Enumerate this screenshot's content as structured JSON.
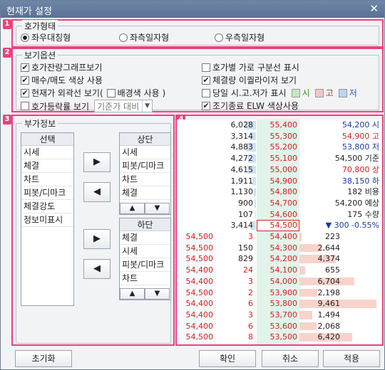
{
  "window": {
    "title": "현재가 설정"
  },
  "markers": [
    "1",
    "2",
    "3",
    "4"
  ],
  "hoga_type": {
    "title": "호가형태",
    "options": [
      {
        "label": "좌우대칭형",
        "selected": true
      },
      {
        "label": "좌측일자형",
        "selected": false
      },
      {
        "label": "우측일자형",
        "selected": false
      }
    ]
  },
  "view_options": {
    "title": "보기옵션",
    "left": [
      {
        "label": "호가잔량그래프보기",
        "checked": true
      },
      {
        "label": "매수/매도 색상 사용",
        "checked": true
      },
      {
        "label": "현재가 외곽선 보기(",
        "checked": true,
        "sub_label": "배경색 사용 )",
        "sub_checked": false
      },
      {
        "label": "호가등락률 보기",
        "checked": false,
        "combo": "기준가 대비"
      }
    ],
    "right": [
      {
        "label": "호가별 가로 구분선 표시",
        "checked": false
      },
      {
        "label": "체결량 이퀄라이저 보기",
        "checked": true
      },
      {
        "label": "당일 시.고.저가 표시",
        "checked": false,
        "colors": [
          {
            "label": "시",
            "color": "#c7e6bf"
          },
          {
            "label": "고",
            "color": "#f3c6c6"
          },
          {
            "label": "저",
            "color": "#bcd3f1"
          }
        ]
      },
      {
        "label": "조기종료 ELW 색상사용",
        "checked": true
      }
    ]
  },
  "extra_info": {
    "title": "부가정보",
    "select_header": "선택",
    "select_items": [
      "시세",
      "체결",
      "차트",
      "피봇/디마크",
      "체결강도",
      "정보미표시"
    ],
    "top_header": "상단",
    "top_items": [
      "시세",
      "피봇/디마크",
      "차트",
      "체결"
    ],
    "bottom_header": "하단",
    "bottom_items": [
      "체결",
      "시세",
      "피봇/디마크",
      "차트"
    ],
    "arrow_right": "▶",
    "arrow_left": "◀",
    "up": "▲",
    "down": "▼"
  },
  "preview": {
    "ask_rows": [
      {
        "qty": "6,028",
        "price": "55,400",
        "info": "54,200 시",
        "bar": 0.22
      },
      {
        "qty": "3,314",
        "price": "55,300",
        "info": "54,900 고",
        "bar": 0.12
      },
      {
        "qty": "4,883",
        "price": "55,200",
        "info": "53,800 저",
        "bar": 0.18
      },
      {
        "qty": "4,272",
        "price": "55,100",
        "info": "54,500 기준",
        "bar": 0.16
      },
      {
        "qty": "4,615",
        "price": "55,000",
        "info": "70,800 상",
        "bar": 0.17
      },
      {
        "qty": "1,911",
        "price": "54,900",
        "info": "38,150 하",
        "bar": 0.07
      },
      {
        "qty": "1,130",
        "price": "54,800",
        "info": "182 비용",
        "bar": 0.04
      },
      {
        "qty": "900",
        "price": "54,700",
        "info": "54,200 예상",
        "bar": 0.03
      },
      {
        "qty": "107",
        "price": "54,600",
        "info": "175 수량",
        "bar": 0.01
      },
      {
        "qty": "3,414",
        "price": "54,500",
        "info": "▼ 300      -0.55%",
        "bar": 0.12
      }
    ],
    "bid_rows": [
      {
        "trade_price": "54,500",
        "trade_qty": "3",
        "price": "54,400",
        "qty": "223",
        "bar": 0.03
      },
      {
        "trade_price": "54,500",
        "trade_qty": "150",
        "price": "54,300",
        "qty": "2,644",
        "bar": 0.28
      },
      {
        "trade_price": "54,500",
        "trade_qty": "829",
        "price": "54,200",
        "qty": "4,374",
        "bar": 0.46
      },
      {
        "trade_price": "54,400",
        "trade_qty": "24",
        "price": "54,100",
        "qty": "655",
        "bar": 0.07
      },
      {
        "trade_price": "54,400",
        "trade_qty": "3",
        "price": "54,000",
        "qty": "6,704",
        "bar": 0.7
      },
      {
        "trade_price": "54,500",
        "trade_qty": "2",
        "price": "53,900",
        "qty": "2,198",
        "bar": 0.23
      },
      {
        "trade_price": "54,400",
        "trade_qty": "6",
        "price": "53,800",
        "qty": "9,461",
        "bar": 0.98
      },
      {
        "trade_price": "54,400",
        "trade_qty": "3",
        "price": "53,700",
        "qty": "1,494",
        "bar": 0.16
      },
      {
        "trade_price": "54,400",
        "trade_qty": "6",
        "price": "53,600",
        "qty": "2,068",
        "bar": 0.22
      },
      {
        "trade_price": "54,500",
        "trade_qty": "8",
        "price": "53,500",
        "qty": "6,420",
        "bar": 0.67
      }
    ],
    "colors": {
      "ask_bar": "#cfe0f4",
      "bid_bar": "#f7d3cc",
      "price_bg": "#e2f4ea",
      "current_border": "#d02020"
    }
  },
  "footer": {
    "reset": "초기화",
    "ok": "확인",
    "cancel": "취소",
    "apply": "적용"
  }
}
